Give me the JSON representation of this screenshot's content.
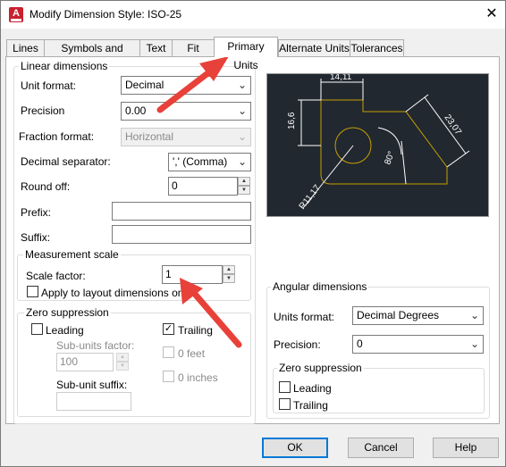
{
  "window": {
    "title": "Modify Dimension Style: ISO-25",
    "app_icon_letter": "A"
  },
  "tabs": [
    {
      "label": "Lines"
    },
    {
      "label": "Symbols and Arrows"
    },
    {
      "label": "Text"
    },
    {
      "label": "Fit"
    },
    {
      "label": "Primary Units"
    },
    {
      "label": "Alternate Units"
    },
    {
      "label": "Tolerances"
    }
  ],
  "linear": {
    "legend": "Linear dimensions",
    "unit_format_label": "Unit format:",
    "unit_format_value": "Decimal",
    "precision_label": "Precision",
    "precision_value": "0.00",
    "fraction_format_label": "Fraction format:",
    "fraction_format_value": "Horizontal",
    "decimal_separator_label": "Decimal separator:",
    "decimal_separator_value": "',' (Comma)",
    "round_off_label": "Round off:",
    "round_off_value": "0",
    "prefix_label": "Prefix:",
    "prefix_value": "",
    "suffix_label": "Suffix:",
    "suffix_value": ""
  },
  "measurement": {
    "legend": "Measurement scale",
    "scale_factor_label": "Scale factor:",
    "scale_factor_value": "1",
    "apply_layout_label": "Apply to layout dimensions only"
  },
  "zero_linear": {
    "legend": "Zero suppression",
    "leading_label": "Leading",
    "trailing_label": "Trailing",
    "sub_units_factor_label": "Sub-units factor:",
    "sub_units_factor_value": "100",
    "sub_unit_suffix_label": "Sub-unit suffix:",
    "feet_label": "0 feet",
    "inches_label": "0 inches",
    "trailing_checked": "✓"
  },
  "angular": {
    "legend": "Angular dimensions",
    "units_format_label": "Units format:",
    "units_format_value": "Decimal Degrees",
    "precision_label": "Precision:",
    "precision_value": "0",
    "zero_legend": "Zero suppression",
    "leading_label": "Leading",
    "trailing_label": "Trailing"
  },
  "preview": {
    "dim_top": "14,11",
    "dim_left": "16,6",
    "dim_right": "23,07",
    "dim_angle": "80°",
    "dim_radius": "R11,17"
  },
  "buttons": {
    "ok": "OK",
    "cancel": "Cancel",
    "help": "Help"
  },
  "colors": {
    "annotation_arrow": "#e8413a",
    "preview_bg": "#212830",
    "geometry": "#c8a000",
    "focus_blue": "#0078d7"
  }
}
